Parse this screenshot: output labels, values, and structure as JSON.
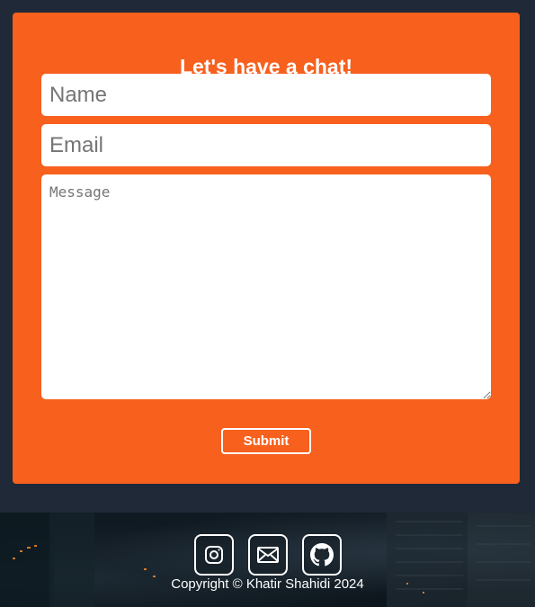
{
  "contact": {
    "title": "Let's have a chat!",
    "name_placeholder": "Name",
    "email_placeholder": "Email",
    "message_placeholder": "Message",
    "submit_label": "Submit",
    "accent_color": "#f7601d"
  },
  "footer": {
    "social_links": [
      {
        "icon": "instagram-icon"
      },
      {
        "icon": "mail-icon"
      },
      {
        "icon": "github-icon"
      }
    ],
    "copyright": "Copyright © Khatir Shahidi 2024"
  }
}
